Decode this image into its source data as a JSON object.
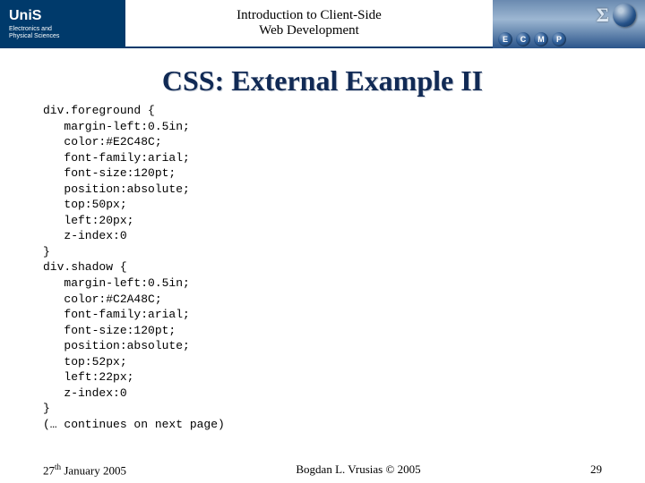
{
  "header": {
    "brand": "UniS",
    "dept_line1": "Electronics and",
    "dept_line2": "Physical Sciences",
    "course_line1": "Introduction to Client-Side",
    "course_line2": "Web Development",
    "badges": [
      "E",
      "C",
      "M",
      "P"
    ]
  },
  "title": "CSS: External Example II",
  "code_lines": [
    "div.foreground {",
    "   margin-left:0.5in;",
    "   color:#E2C48C;",
    "   font-family:arial;",
    "   font-size:120pt;",
    "   position:absolute;",
    "   top:50px;",
    "   left:20px;",
    "   z-index:0",
    "}",
    "div.shadow {",
    "   margin-left:0.5in;",
    "   color:#C2A48C;",
    "   font-family:arial;",
    "   font-size:120pt;",
    "   position:absolute;",
    "   top:52px;",
    "   left:22px;",
    "   z-index:0",
    "}",
    "(… continues on next page)"
  ],
  "footer": {
    "date_day": "27",
    "date_ord": "th",
    "date_rest": " January 2005",
    "author": "Bogdan L. Vrusias © 2005",
    "page": "29"
  }
}
